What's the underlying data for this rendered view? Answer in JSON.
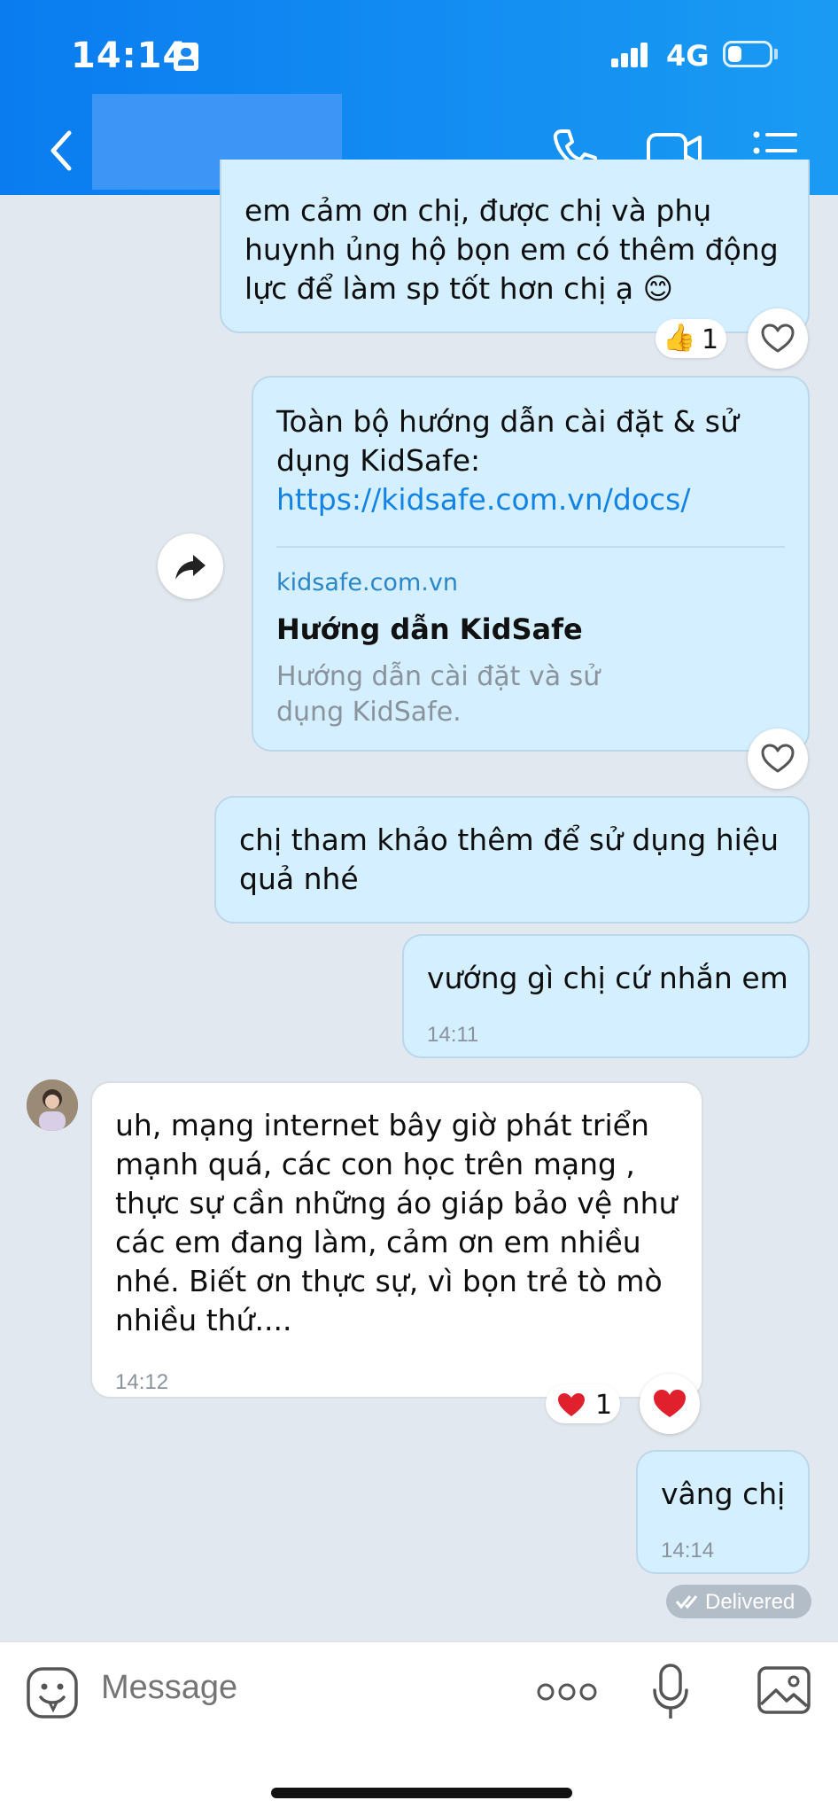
{
  "status_bar": {
    "time": "14:14",
    "network": "4G",
    "battery_level": 0.35
  },
  "header": {
    "back_icon": "chevron-left-icon",
    "contact_name": "",
    "call_icon": "phone-icon",
    "video_icon": "video-camera-icon",
    "menu_icon": "list-menu-icon"
  },
  "messages": {
    "m1": {
      "line1": "em cảm ơn chị, được chị và phụ",
      "line2": "huynh ủng hộ bọn em có thêm động",
      "line3": "lực để làm sp tốt hơn chị ạ",
      "emoji": "😊",
      "reaction_emoji": "👍",
      "reaction_count": "1"
    },
    "m2": {
      "line1": "Toàn bộ hướng dẫn cài đặt & sử",
      "line2": "dụng KidSafe:",
      "link": "https://kidsafe.com.vn/docs/",
      "preview_domain": "kidsafe.com.vn",
      "preview_title": "Hướng dẫn KidSafe",
      "preview_desc1": "Hướng dẫn cài đặt và sử",
      "preview_desc2": "dụng KidSafe."
    },
    "m3": {
      "line1": "chị tham khảo thêm để sử dụng hiệu",
      "line2": "quả nhé"
    },
    "m4": {
      "text": "vướng gì chị cứ nhắn em",
      "time": "14:11"
    },
    "m5": {
      "line1": "uh, mạng internet bây giờ phát triển",
      "line2": "mạnh quá, các con học  trên mạng ,",
      "line3": "thực sự cần những áo giáp bảo vệ như",
      "line4": "các em đang làm, cảm ơn em nhiều",
      "line5": "nhé. Biết ơn thực sự, vì bọn trẻ tò mò",
      "line6": "nhiều thứ....",
      "time": "14:12",
      "reaction_emoji": "❤️",
      "reaction_count": "1"
    },
    "m6": {
      "text": "vâng chị",
      "time": "14:14"
    },
    "status": "Delivered"
  },
  "composer": {
    "placeholder": "Message",
    "sticker_icon": "sticker-smile-icon",
    "more_icon": "more-dots-icon",
    "mic_icon": "microphone-icon",
    "image_icon": "image-icon"
  },
  "colors": {
    "header": "#0a7cf0",
    "bubble_out": "#d4efff",
    "bubble_in": "#ffffff",
    "background": "#e2e8ef",
    "link": "#1283e4"
  }
}
